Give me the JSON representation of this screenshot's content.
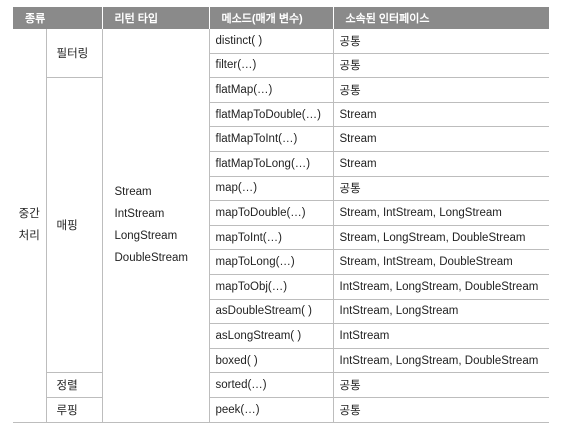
{
  "headers": {
    "kind": "종류",
    "return_type": "리턴 타입",
    "method": "메소드(매개 변수)",
    "interface": "소속된 인터페이스"
  },
  "group": {
    "line1": "중간",
    "line2": "처리"
  },
  "return_types": [
    "Stream",
    "IntStream",
    "LongStream",
    "DoubleStream"
  ],
  "kinds": {
    "filtering": "필터링",
    "mapping": "매핑",
    "sorting": "정렬",
    "looping": "루핑"
  },
  "rows": [
    {
      "method": "distinct( )",
      "interface": "공통"
    },
    {
      "method": "filter(…)",
      "interface": "공통"
    },
    {
      "method": "flatMap(…)",
      "interface": "공통"
    },
    {
      "method": "flatMapToDouble(…)",
      "interface": "Stream"
    },
    {
      "method": "flatMapToInt(…)",
      "interface": "Stream"
    },
    {
      "method": "flatMapToLong(…)",
      "interface": "Stream"
    },
    {
      "method": "map(…)",
      "interface": "공통"
    },
    {
      "method": "mapToDouble(…)",
      "interface": "Stream, IntStream, LongStream"
    },
    {
      "method": "mapToInt(…)",
      "interface": "Stream, LongStream, DoubleStream"
    },
    {
      "method": "mapToLong(…)",
      "interface": "Stream, IntStream, DoubleStream"
    },
    {
      "method": "mapToObj(…)",
      "interface": "IntStream, LongStream, DoubleStream"
    },
    {
      "method": "asDoubleStream( )",
      "interface": "IntStream, LongStream"
    },
    {
      "method": "asLongStream( )",
      "interface": "IntStream"
    },
    {
      "method": "boxed( )",
      "interface": "IntStream, LongStream, DoubleStream"
    },
    {
      "method": "sorted(…)",
      "interface": "공통"
    },
    {
      "method": "peek(…)",
      "interface": "공통"
    }
  ]
}
